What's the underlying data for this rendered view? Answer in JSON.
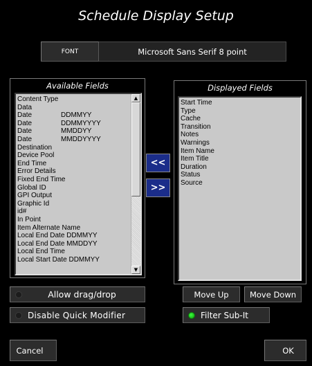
{
  "window": {
    "title": "Schedule Display Setup"
  },
  "font": {
    "button_label": "FONT",
    "value": "Microsoft Sans Serif 8 point"
  },
  "available_fields": {
    "title": "Available Fields",
    "items": [
      {
        "name": "Content Type",
        "format": ""
      },
      {
        "name": "Data",
        "format": ""
      },
      {
        "name": "Date",
        "format": "DDMMYY"
      },
      {
        "name": "Date",
        "format": "DDMMYYYY"
      },
      {
        "name": "Date",
        "format": "MMDDYY"
      },
      {
        "name": "Date",
        "format": "MMDDYYYY"
      },
      {
        "name": "Destination",
        "format": ""
      },
      {
        "name": "Device Pool",
        "format": ""
      },
      {
        "name": "End Time",
        "format": ""
      },
      {
        "name": "Error Details",
        "format": ""
      },
      {
        "name": "Fixed End Time",
        "format": ""
      },
      {
        "name": "Global ID",
        "format": ""
      },
      {
        "name": "GPI Output",
        "format": ""
      },
      {
        "name": "Graphic Id",
        "format": ""
      },
      {
        "name": "id#",
        "format": ""
      },
      {
        "name": "In Point",
        "format": ""
      },
      {
        "name": "Item Alternate Name",
        "format": ""
      },
      {
        "name": "Local End Date DDMMYY",
        "format": ""
      },
      {
        "name": "Local End Date MMDDYY",
        "format": ""
      },
      {
        "name": "Local End Time",
        "format": ""
      },
      {
        "name": "Local Start Date DDMMYY",
        "format": ""
      }
    ]
  },
  "displayed_fields": {
    "title": "Displayed Fields",
    "items": [
      "Start Time",
      "Type",
      "Cache",
      "Transition",
      "Notes",
      "Warnings",
      "Item Name",
      "Item Title",
      "Duration",
      "Status",
      "Source"
    ]
  },
  "transfer": {
    "add_label": "<<",
    "remove_label": ">>"
  },
  "options": {
    "allow_drag_drop": {
      "label": "Allow drag/drop",
      "checked": false
    },
    "disable_quick_modifier": {
      "label": "Disable  Quick Modifier",
      "checked": false
    },
    "filter_sub_it": {
      "label": "Filter  Sub-It",
      "checked": true,
      "led_color": "#2ee82e"
    }
  },
  "ordering": {
    "move_up_label": "Move Up",
    "move_down_label": "Move Down"
  },
  "footer": {
    "cancel_label": "Cancel",
    "ok_label": "OK"
  },
  "colors": {
    "background": "#000000",
    "arrow_button": "#1b2d8a",
    "list_background": "#c9c9c9"
  }
}
